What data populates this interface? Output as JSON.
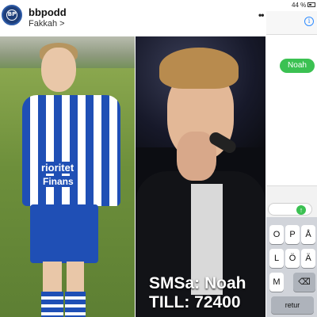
{
  "post": {
    "username": "bbpodd",
    "location": "Fakkah",
    "location_chevron": ">",
    "more_glyph": "••",
    "avatar_text": "BP"
  },
  "left_photo": {
    "sponsor_line1": "rioritet",
    "sponsor_line2": "Finans"
  },
  "right_photo": {
    "overlay_line1": "SMSa: Noah",
    "overlay_line2": "TILL: 72400"
  },
  "imessage": {
    "battery_percent": "44 %",
    "info_glyph": "i",
    "bubble_text": "Noah",
    "send_glyph": "↑",
    "keyboard_keys": [
      "O",
      "P",
      "Å",
      "L",
      "Ö",
      "Ä",
      "M"
    ],
    "backspace_glyph": "⌫",
    "return_label": "retur"
  },
  "colors": {
    "imessage_green": "#3bc152",
    "jersey_blue": "#1f4fb5",
    "info_blue": "#2f8cff"
  }
}
